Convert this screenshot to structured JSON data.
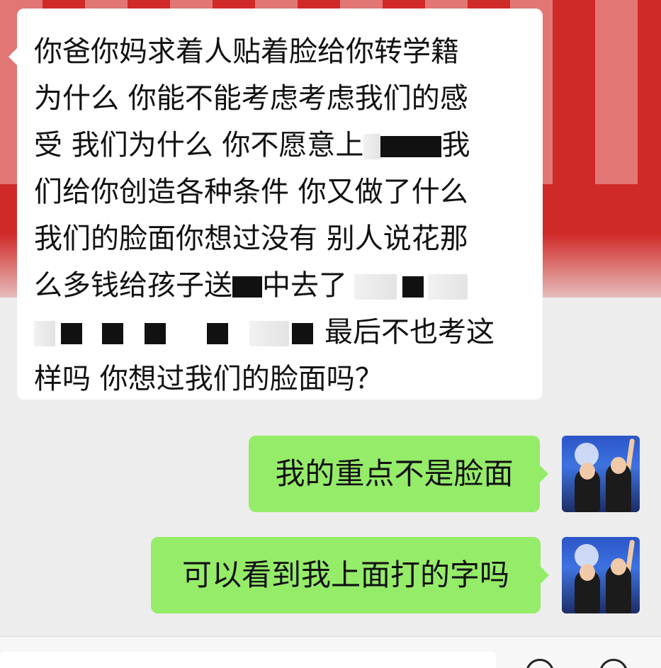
{
  "background": {
    "color": "#d02a28"
  },
  "messages": [
    {
      "side": "left",
      "lines": [
        {
          "segments": [
            {
              "text": "你爸你妈求着人贴着脸给你转学籍"
            }
          ]
        },
        {
          "segments": [
            {
              "text": "为什么 你能不能考虑考虑我们的感"
            }
          ]
        },
        {
          "segments": [
            {
              "text": "受 我们为什么 你不愿意上"
            },
            {
              "redact": 1
            },
            {
              "text": "我"
            }
          ]
        },
        {
          "segments": [
            {
              "text": "们给你创造各种条件 你又做了什么"
            }
          ]
        },
        {
          "segments": [
            {
              "text": "我们的脸面你想过没有 别人说花那"
            }
          ]
        },
        {
          "segments": [
            {
              "text": "么多钱给孩子送"
            },
            {
              "redact": 1
            },
            {
              "text": "中去了"
            },
            {
              "redact": 2
            }
          ]
        },
        {
          "segments": [
            {
              "redact": 3
            },
            {
              "text": "最后不也考这"
            }
          ]
        },
        {
          "segments": [
            {
              "text": "样吗 你想过我们的脸面吗？"
            }
          ]
        }
      ]
    },
    {
      "side": "right",
      "text": "我的重点不是脸面"
    },
    {
      "side": "right",
      "text": "可以看到我上面打的字吗"
    }
  ],
  "colors": {
    "right_bubble": "#95ec69",
    "left_bubble": "#ffffff",
    "chat_bg": "#ededed"
  },
  "icons": {
    "avatar": "user-avatar-photo",
    "voice": "voice-icon",
    "emoji": "emoji-icon"
  }
}
